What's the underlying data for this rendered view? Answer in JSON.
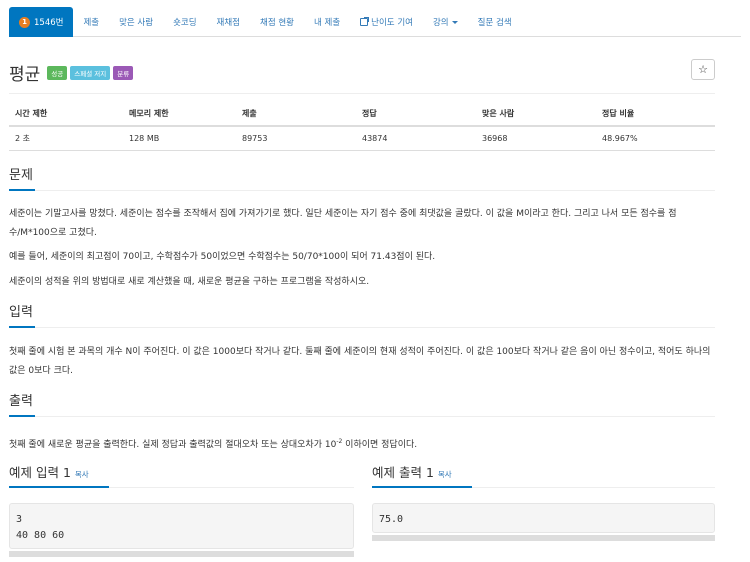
{
  "nav": {
    "problem_number": "1546번",
    "badge": "1",
    "tabs": [
      "제출",
      "맞은 사람",
      "숏코딩",
      "재채점",
      "채점 현황",
      "내 제출",
      "난이도 기여",
      "강의",
      "질문 검색"
    ]
  },
  "problem": {
    "title": "평균",
    "labels": [
      {
        "text": "성공",
        "color": "#5cb85c"
      },
      {
        "text": "스페셜 저지",
        "color": "#5bc0de"
      },
      {
        "text": "분류",
        "color": "#9b59b6"
      }
    ],
    "star": "☆"
  },
  "info": {
    "headers": [
      "시간 제한",
      "메모리 제한",
      "제출",
      "정답",
      "맞은 사람",
      "정답 비율"
    ],
    "values": [
      "2 초",
      "128 MB",
      "89753",
      "43874",
      "36968",
      "48.967%"
    ]
  },
  "sections": {
    "problem_title": "문제",
    "problem_p1": "세준이는 기말고사를 망쳤다. 세준이는 점수를 조작해서 집에 가져가기로 했다. 일단 세준이는 자기 점수 중에 최댓값을 골랐다. 이 값을 M이라고 한다. 그리고 나서 모든 점수를 점수/M*100으로 고쳤다.",
    "problem_p2": "예를 들어, 세준이의 최고점이 70이고, 수학점수가 50이었으면 수학점수는 50/70*100이 되어 71.43점이 된다.",
    "problem_p3": "세준이의 성적을 위의 방법대로 새로 계산했을 때, 새로운 평균을 구하는 프로그램을 작성하시오.",
    "input_title": "입력",
    "input_p1": "첫째 줄에 시험 본 과목의 개수 N이 주어진다. 이 값은 1000보다 작거나 같다. 둘째 줄에 세준이의 현재 성적이 주어진다. 이 값은 100보다 작거나 같은 음이 아닌 정수이고, 적어도 하나의 값은 0보다 크다.",
    "output_title": "출력",
    "output_p1_pre": "첫째 줄에 새로운 평균을 출력한다. 실제 정답과 출력값의 절대오차 또는 상대오차가 10",
    "output_p1_sup": "-2",
    "output_p1_post": " 이하이면 정답이다."
  },
  "samples": {
    "input_title": "예제 입력 1",
    "output_title": "예제 출력 1",
    "copy_label": "복사",
    "input_text": "3\n40 80 60",
    "output_text": "75.0"
  }
}
